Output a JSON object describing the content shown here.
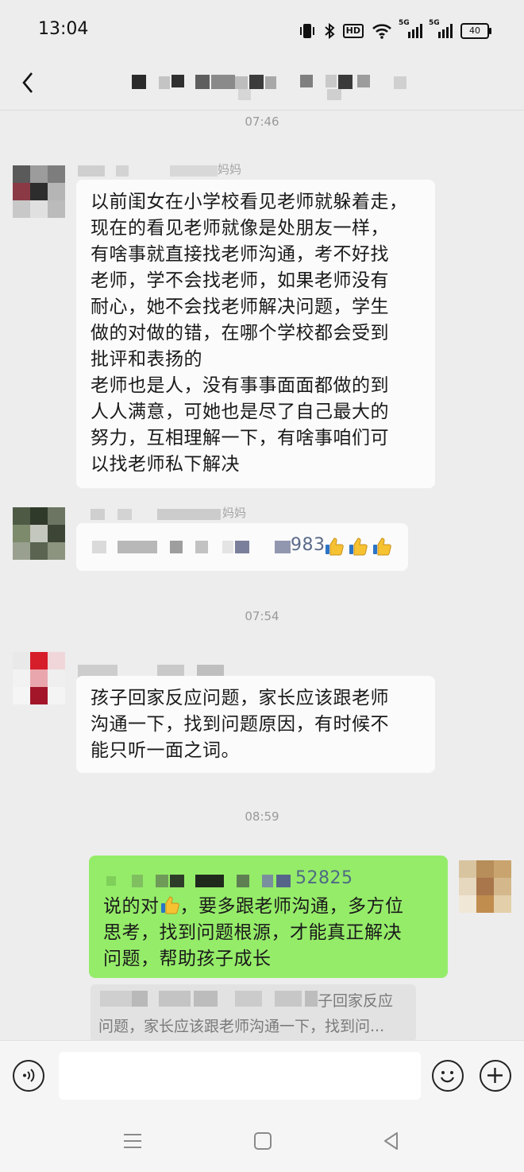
{
  "status_bar": {
    "time": "13:04",
    "icons": [
      "vibrate-icon",
      "bluetooth-icon",
      "hd-icon",
      "wifi-icon",
      "signal-5g-icon",
      "signal-5g-icon",
      "battery-icon"
    ],
    "hd_label": "HD",
    "net1": "5G",
    "net2": "5G",
    "battery_level": "40"
  },
  "header": {
    "back_icon": "chevron-left-icon",
    "title": ""
  },
  "messages": [
    {
      "type": "timestamp",
      "text": "07:46"
    },
    {
      "type": "incoming",
      "sender_visible": "妈妈",
      "lines": [
        "以前闺女在小学校看见老师就躲着走，",
        "现在的看见老师就像是处朋友一样，",
        "有啥事就直接找老师沟通，考不好找",
        "老师，学不会找老师，如果老师没有",
        "耐心，她不会找老师解决问题，学生",
        "做的对做的错，在哪个学校都会受到",
        "批评和表扬的",
        "老师也是人，没有事事面面都做的到",
        "人人满意，可她也是尽了自己最大的",
        "努力，互相理解一下，有啥事咱们可",
        "以找老师私下解决"
      ]
    },
    {
      "type": "incoming",
      "sender_visible": "妈妈",
      "text_visible": "983",
      "emoji": [
        "thumbs-up-icon",
        "thumbs-up-icon",
        "thumbs-up-icon"
      ]
    },
    {
      "type": "timestamp",
      "text": "07:54"
    },
    {
      "type": "incoming",
      "sender_visible": "",
      "lines": [
        "孩子回家反应问题，家长应该跟老师",
        "沟通一下，找到问题原因，有时候不",
        "能只听一面之词。"
      ]
    },
    {
      "type": "timestamp",
      "text": "08:59"
    },
    {
      "type": "outgoing",
      "mention_visible": "52825",
      "line1_a": "说的对",
      "line1_b": "，要多跟老师沟通，多方位",
      "line2": "思考，找到问题根源，才能真正解决",
      "line3": "问题，帮助孩子成长",
      "emoji": "thumbs-up-icon"
    }
  ],
  "quote": {
    "line1_visible": "子回家反应",
    "line2_visible": "问题，家长应该跟老师沟通一下，找到问..."
  },
  "input_bar": {
    "voice_icon": "voice-icon",
    "placeholder": "",
    "emoji_icon": "smile-icon",
    "plus_icon": "plus-icon"
  },
  "system_nav": [
    "menu-icon",
    "home-icon",
    "back-triangle-icon"
  ],
  "colors": {
    "background": "#ededed",
    "incoming_bubble": "#fbfbfb",
    "outgoing_bubble": "#95ec69",
    "timestamp": "#9a9a9a",
    "mention_text": "#5b6b8a"
  }
}
